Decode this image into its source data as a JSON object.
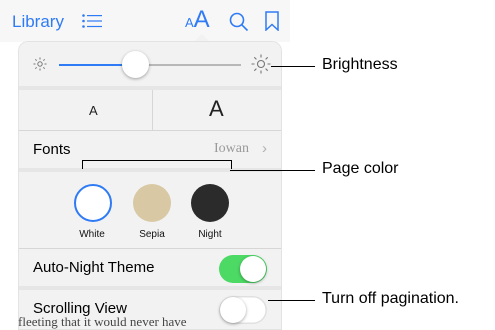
{
  "toolbar": {
    "library_label": "Library",
    "font_small": "A",
    "font_big": "A",
    "list_icon": "list-icon",
    "search_icon": "search-icon",
    "bookmark_icon": "bookmark-icon",
    "accent": "#2f7bf5"
  },
  "popover": {
    "brightness": {
      "low_icon": "sun-small-icon",
      "high_icon": "sun-large-icon",
      "level": 0.42
    },
    "text_size": {
      "smaller_label": "A",
      "larger_label": "A"
    },
    "fonts": {
      "label": "Fonts",
      "value": "Iowan",
      "chevron": "›"
    },
    "page_colors": [
      {
        "label": "White",
        "color": "#ffffff",
        "selected": true
      },
      {
        "label": "Sepia",
        "color": "#d8c9a4",
        "selected": false
      },
      {
        "label": "Night",
        "color": "#2b2b2b",
        "selected": false
      }
    ],
    "auto_night": {
      "label": "Auto-Night Theme",
      "on": true,
      "color": "#4cd964"
    },
    "scrolling_view": {
      "label": "Scrolling View",
      "on": false
    }
  },
  "book_text_peek": "fleeting that it would never have",
  "callouts": {
    "brightness": "Brightness",
    "page_color": "Page color",
    "pagination": "Turn off pagination."
  }
}
